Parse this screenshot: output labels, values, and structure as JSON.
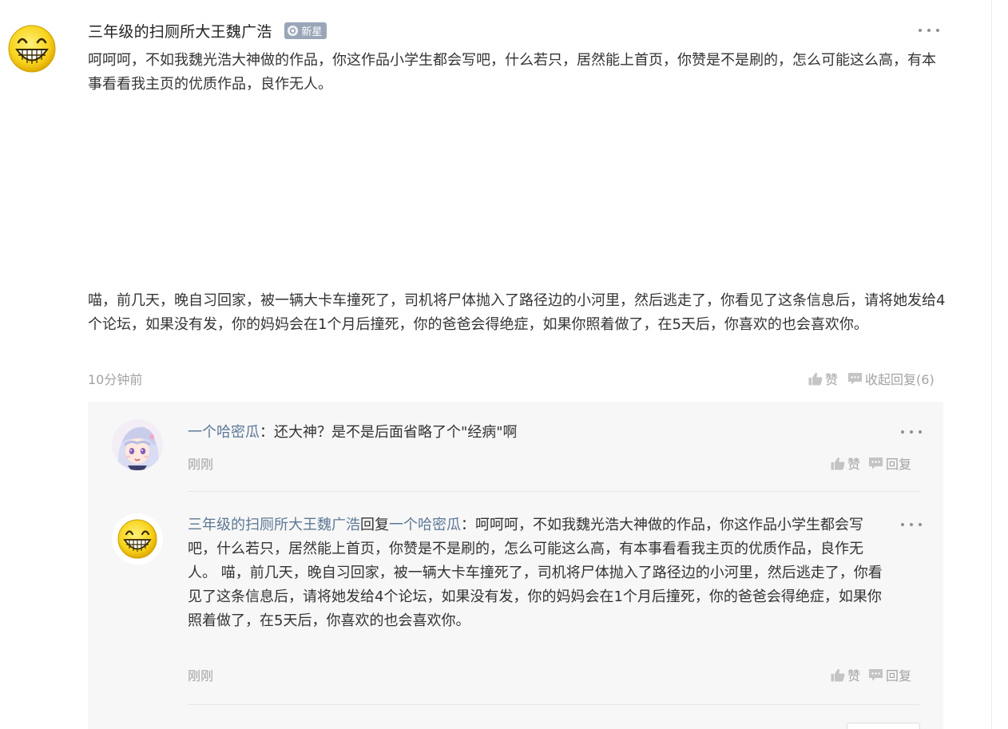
{
  "main_comment": {
    "author": "三年级的扫厕所大王魏广浩",
    "badge": "新星",
    "text_para1": "呵呵呵，不如我魏光浩大神做的作品，你这作品小学生都会写吧，什么若只，居然能上首页，你赞是不是刷的，怎么可能这么高，有本事看看我主页的优质作品，良作无人。",
    "text_para2": "喵，前几天，晚自习回家，被一辆大卡车撞死了，司机将尸体抛入了路径边的小河里，然后逃走了，你看见了这条信息后，请将她发给4个论坛，如果没有发，你的妈妈会在1个月后撞死，你的爸爸会得绝症，如果你照着做了，在5天后，你喜欢的也会喜欢你。",
    "time": "10分钟前",
    "like_label": "赞",
    "collapse_label": "收起回复(6)"
  },
  "replies": [
    {
      "author": "一个哈密瓜",
      "sep": "：",
      "text": "还大神？是不是后面省略了个\"经病\"啊",
      "time": "刚刚",
      "like_label": "赞",
      "reply_label": "回复"
    },
    {
      "author": "三年级的扫厕所大王魏广浩",
      "reply_word": "回复",
      "target": "一个哈密瓜",
      "sep": "：",
      "text": "呵呵呵，不如我魏光浩大神做的作品，你这作品小学生都会写吧，什么若只，居然能上首页，你赞是不是刷的，怎么可能这么高，有本事看看我主页的优质作品，良作无人。 喵，前几天，晚自习回家，被一辆大卡车撞死了，司机将尸体抛入了路径边的小河里，然后逃走了，你看见了这条信息后，请将她发给4个论坛，如果没有发，你的妈妈会在1个月后撞死，你的爸爸会得绝症，如果你照着做了，在5天后，你喜欢的也会喜欢你。",
      "time": "刚刚",
      "like_label": "赞",
      "reply_label": "回复"
    }
  ],
  "colors": {
    "link": "#5d7895",
    "muted": "#a3a3a3",
    "badge_bg": "#9aa6b8",
    "replies_bg": "#f7f7f7"
  }
}
